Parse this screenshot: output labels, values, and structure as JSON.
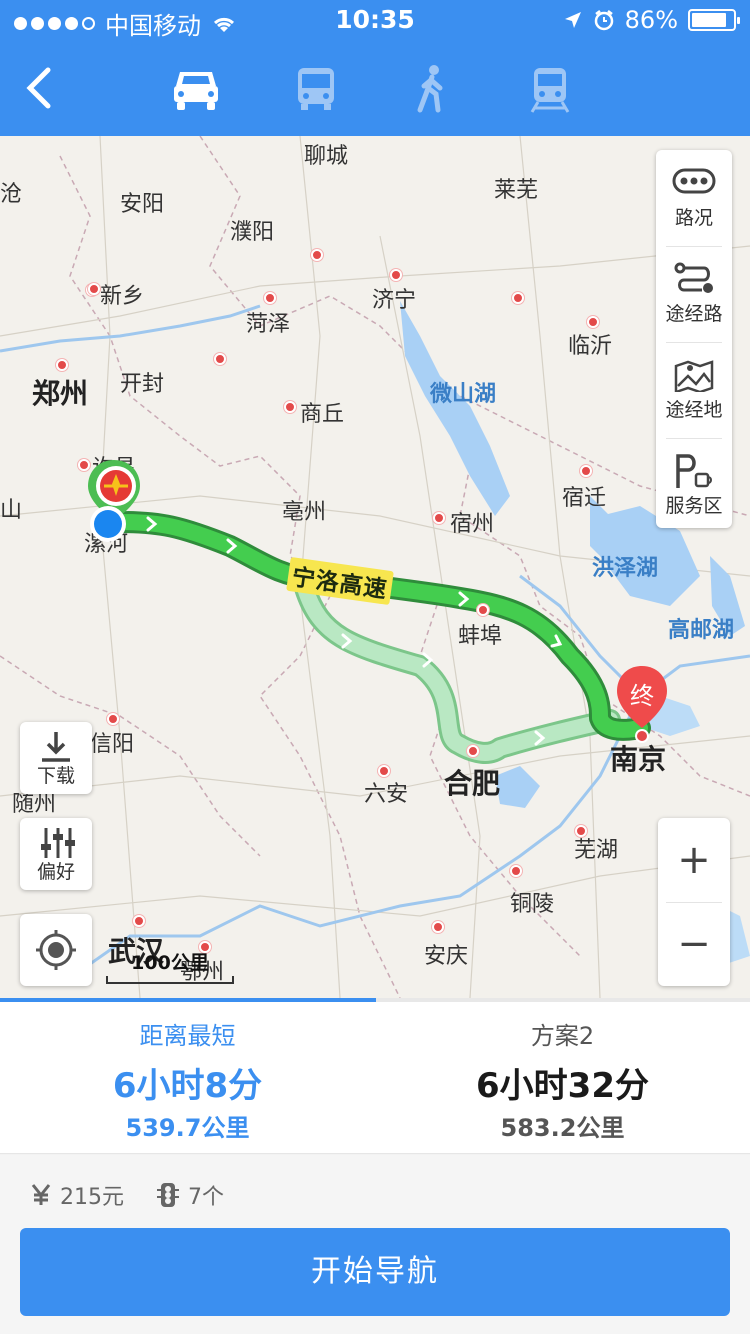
{
  "status_bar": {
    "carrier": "中国移动",
    "time": "10:35",
    "battery": "86%",
    "battery_level": 0.86
  },
  "header": {
    "modes": [
      "car-icon",
      "bus-icon",
      "walk-icon",
      "train-icon"
    ],
    "selected_mode": "car"
  },
  "map": {
    "cities": [
      {
        "name": "聊城"
      },
      {
        "name": "莱芜"
      },
      {
        "name": "安阳"
      },
      {
        "name": "濮阳"
      },
      {
        "name": "新乡"
      },
      {
        "name": "济宁"
      },
      {
        "name": "菏泽"
      },
      {
        "name": "临沂"
      },
      {
        "name": "郑州"
      },
      {
        "name": "开封"
      },
      {
        "name": "商丘"
      },
      {
        "name": "微山湖"
      },
      {
        "name": "许昌"
      },
      {
        "name": "亳州"
      },
      {
        "name": "宿迁"
      },
      {
        "name": "宿州"
      },
      {
        "name": "漯河"
      },
      {
        "name": "洪泽湖"
      },
      {
        "name": "蚌埠"
      },
      {
        "name": "高邮湖"
      },
      {
        "name": "信阳"
      },
      {
        "name": "南京"
      },
      {
        "name": "合肥"
      },
      {
        "name": "六安"
      },
      {
        "name": "随州"
      },
      {
        "name": "芜湖"
      },
      {
        "name": "铜陵"
      },
      {
        "name": "武汉"
      },
      {
        "name": "鄂州"
      },
      {
        "name": "安庆"
      },
      {
        "name": "沧"
      },
      {
        "name": "山"
      }
    ],
    "road_label": "宁洛高速",
    "end_marker": "终",
    "scale_label": "100公里",
    "right_panel": {
      "traffic": "路况",
      "via_road": "途经路",
      "via_place": "途经地",
      "service_area": "服务区"
    },
    "left_panel": {
      "download": "下载",
      "preference": "偏好"
    },
    "zoom": {
      "in": "+",
      "out": "−"
    }
  },
  "routes": [
    {
      "name": "距离最短",
      "time": "6小时8分",
      "distance": "539.7公里",
      "selected": true
    },
    {
      "name": "方案2",
      "time": "6小时32分",
      "distance": "583.2公里",
      "selected": false
    }
  ],
  "details": {
    "toll": "215元",
    "traffic_lights": "7个"
  },
  "start_button": "开始导航",
  "colors": {
    "accent": "#3b8ff0",
    "route_primary": "#3fc44a",
    "route_alt": "#a8e0b5",
    "marker_red": "#e94545"
  }
}
